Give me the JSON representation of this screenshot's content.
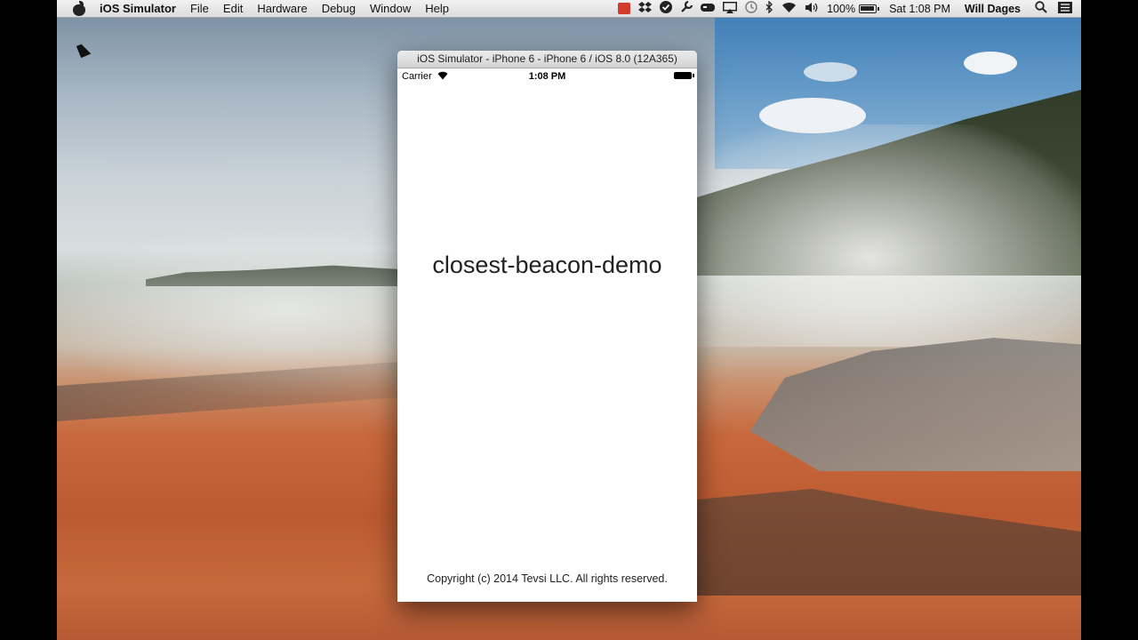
{
  "menubar": {
    "app_name": "iOS Simulator",
    "menus": [
      "File",
      "Edit",
      "Hardware",
      "Debug",
      "Window",
      "Help"
    ],
    "status": {
      "battery_percent": "100%",
      "clock": "Sat 1:08 PM",
      "user": "Will Dages"
    },
    "status_icons": [
      "film-icon",
      "dropbox-icon",
      "checkmark-icon",
      "wrench-icon",
      "gamepad-icon",
      "airplay-icon",
      "time-machine-icon",
      "bluetooth-icon",
      "wifi-icon",
      "volume-icon",
      "battery-icon",
      "search-icon",
      "list-icon"
    ]
  },
  "simulator": {
    "window_title": "iOS Simulator - iPhone 6 - iPhone 6 / iOS 8.0 (12A365)",
    "status_bar": {
      "carrier": "Carrier",
      "time": "1:08 PM"
    },
    "app_title": "closest-beacon-demo",
    "copyright": "Copyright (c) 2014 Tevsi LLC. All rights reserved."
  },
  "colors": {
    "menubar_bg": "#e8e8e8",
    "screen_bg": "#ffffff",
    "film_icon": "#d23b2b"
  }
}
